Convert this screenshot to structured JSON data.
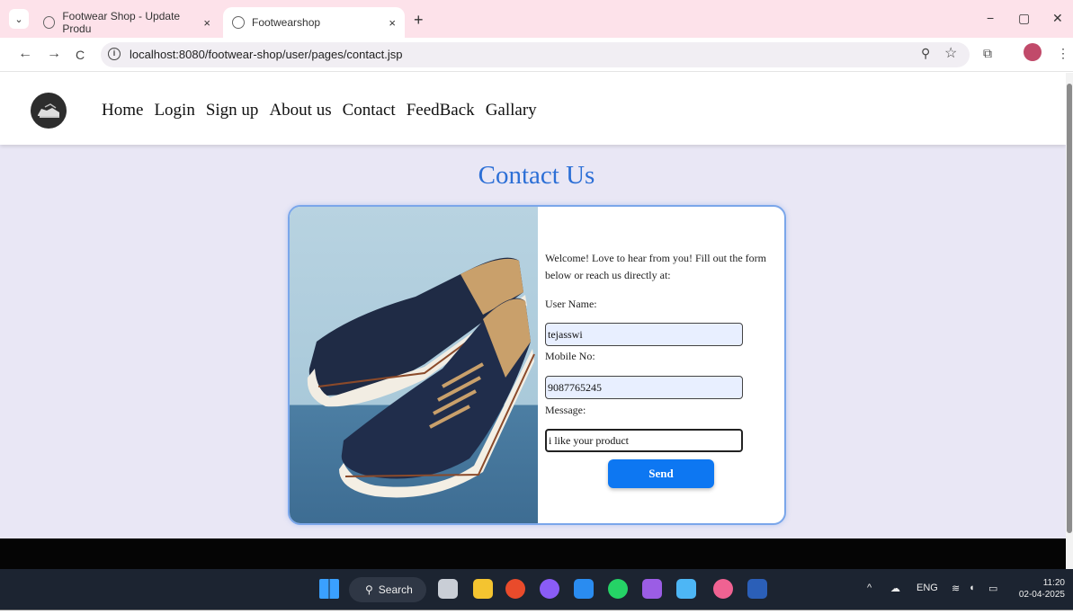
{
  "browser": {
    "tabs": [
      {
        "title": "Footwear Shop - Update Produ",
        "active": false
      },
      {
        "title": "Footwearshop",
        "active": true
      }
    ],
    "url": "localhost:8080/footwear-shop/user/pages/contact.jsp",
    "icons": {
      "back": "←",
      "forward": "→",
      "reload": "C",
      "new_tab": "+",
      "close_tab": "×",
      "minimize": "−",
      "restore": "▢",
      "close_window": "✕",
      "zoom": "⚲",
      "star": "☆",
      "extensions": "⧉",
      "menu": "⋮",
      "tab_search": "⌄"
    }
  },
  "site": {
    "nav": [
      "Home",
      "Login",
      "Sign up",
      "About us",
      "Contact",
      "FeedBack",
      "Gallary"
    ],
    "heading": "Contact Us",
    "form": {
      "welcome": "Welcome! Love to hear from you! Fill out the form below or reach us directly at:",
      "username_label": "User Name:",
      "username_value": "tejasswi",
      "mobile_label": "Mobile No:",
      "mobile_value": "9087765245",
      "message_label": "Message:",
      "message_value": "i like your product",
      "send_label": "Send"
    },
    "colors": {
      "heading": "#2c6fd6",
      "button": "#0d77f2",
      "page_bg": "#e9e7f5"
    }
  },
  "taskbar": {
    "search_label": "Search",
    "language": "ENG",
    "time": "11:20",
    "date": "02-04-2025"
  }
}
